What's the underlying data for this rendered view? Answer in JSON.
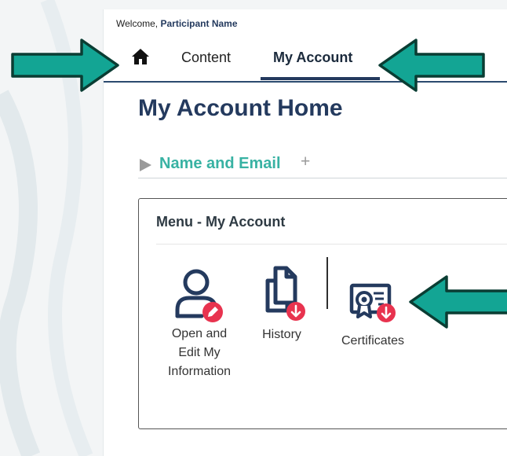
{
  "header": {
    "welcome_prefix": "Welcome,",
    "participant_name": "Participant Name"
  },
  "nav": {
    "home_icon": "home-icon",
    "tabs": [
      {
        "label": "Content",
        "active": false
      },
      {
        "label": "My Account",
        "active": true
      }
    ]
  },
  "page": {
    "title": "My Account Home"
  },
  "section": {
    "title": "Name and Email",
    "expand_symbol": "+"
  },
  "menu": {
    "title": "Menu - My Account",
    "items": [
      {
        "label_lines": [
          "Open and",
          "Edit My",
          "Information"
        ],
        "icon": "user-edit-icon"
      },
      {
        "label": "History",
        "icon": "documents-download-icon"
      },
      {
        "label": "Certificates",
        "icon": "certificate-download-icon"
      }
    ]
  },
  "colors": {
    "navy": "#243a5e",
    "teal_heading": "#38b2a3",
    "badge_red": "#e8334f",
    "annotation_arrow": "#13a594"
  }
}
